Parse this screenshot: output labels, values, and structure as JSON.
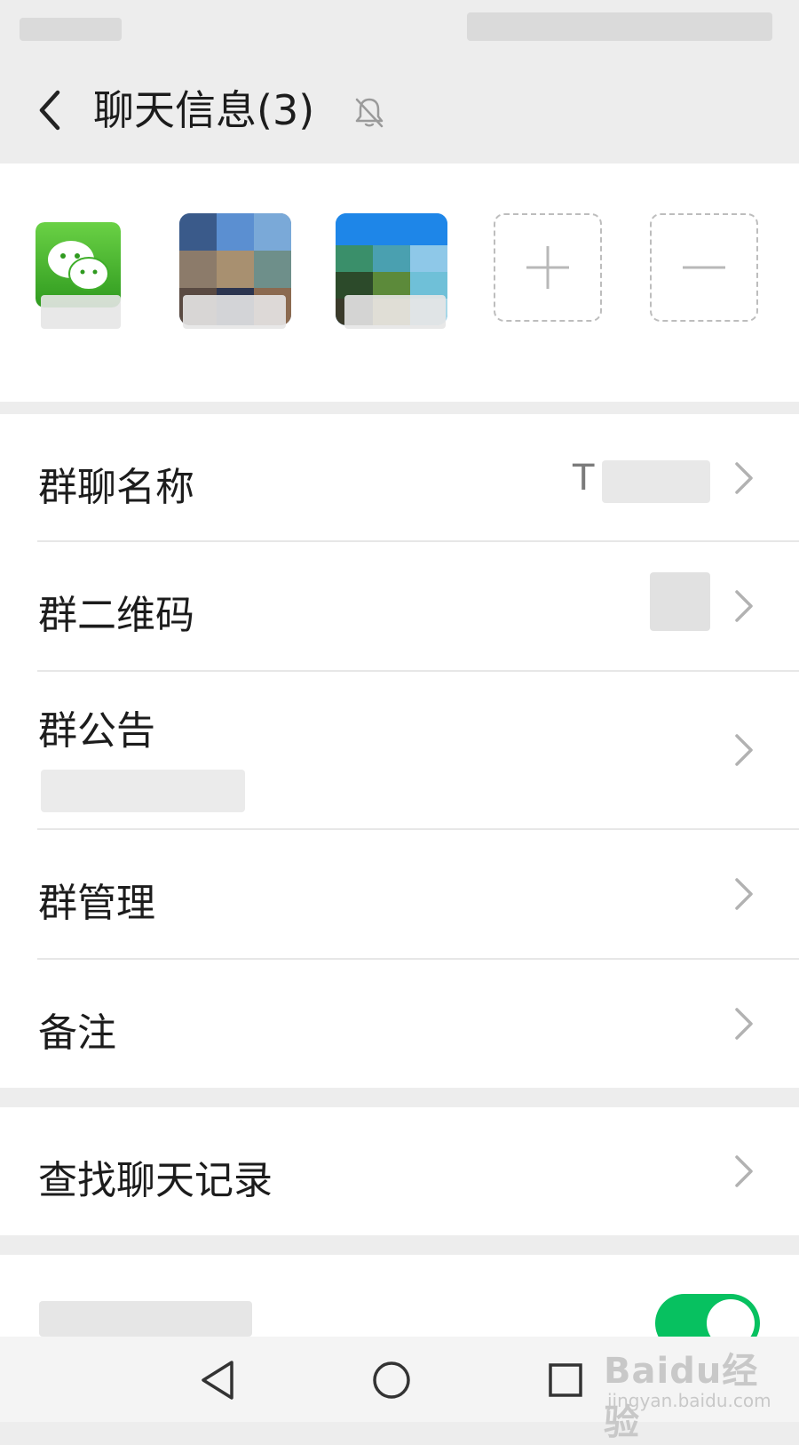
{
  "header": {
    "title": "聊天信息(3)",
    "back_icon": "back-arrow-icon",
    "mute_icon": "muted-bell-icon"
  },
  "members": {
    "add_icon": "plus-icon",
    "remove_icon": "minus-icon"
  },
  "settings": {
    "group_name": {
      "label": "群聊名称",
      "value": "T"
    },
    "qr_code": {
      "label": "群二维码"
    },
    "announcement": {
      "label": "群公告"
    },
    "manage": {
      "label": "群管理"
    },
    "remark": {
      "label": "备注"
    }
  },
  "search": {
    "label": "查找聊天记录"
  },
  "toggle_row": {
    "state": "on",
    "color": "#07c160"
  },
  "watermark": {
    "brand": "Baidu经验",
    "url": "jingyan.baidu.com"
  },
  "colors": {
    "accent": "#07c160",
    "background": "#ededed"
  }
}
